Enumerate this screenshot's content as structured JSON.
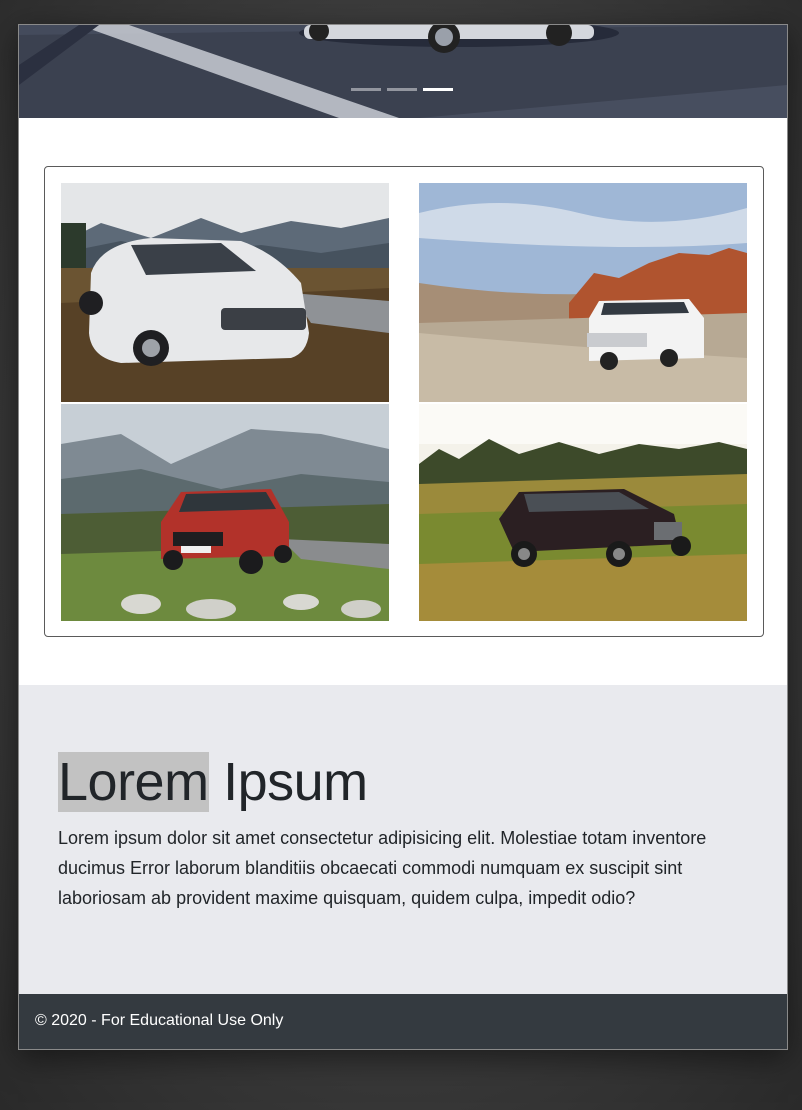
{
  "hero": {
    "slide_count": 3,
    "active_slide": 3
  },
  "gallery": {
    "images": [
      {
        "name": "silver-volvo-wagon-mountains"
      },
      {
        "name": "white-suv-red-rocks"
      },
      {
        "name": "red-volvo-suv-hills"
      },
      {
        "name": "black-suv-grass-field"
      }
    ]
  },
  "about": {
    "heading_highlight": "Lorem",
    "heading_rest": " Ipsum",
    "body": "Lorem ipsum dolor sit amet consectetur adipisicing elit. Molestiae totam inventore ducimus Error laborum blanditiis obcaecati commodi numquam ex suscipit sint laboriosam ab provident maxime quisquam, quidem culpa, impedit odio?"
  },
  "footer": {
    "text": "© 2020 - For Educational Use Only"
  },
  "colors": {
    "footer_bg": "#343a40",
    "section_bg": "#e9eaee",
    "highlight": "#c2c2c2"
  }
}
